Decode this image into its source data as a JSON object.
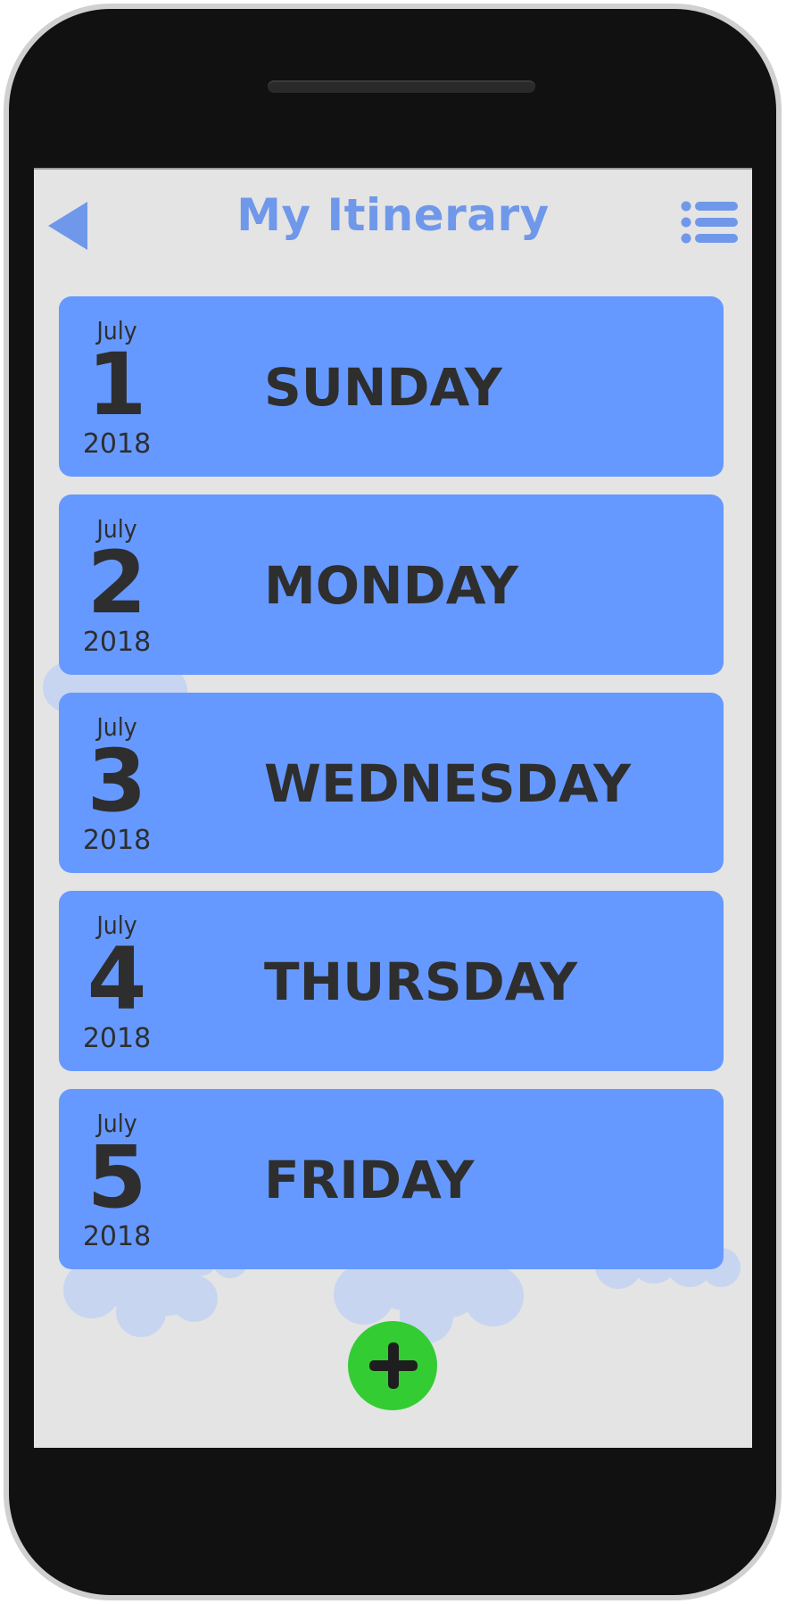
{
  "header": {
    "title": "My Itinerary",
    "back_icon": "back-arrow-icon",
    "menu_icon": "list-menu-icon"
  },
  "days": [
    {
      "month": "July",
      "day": "1",
      "year": "2018",
      "weekday": "SUNDAY"
    },
    {
      "month": "July",
      "day": "2",
      "year": "2018",
      "weekday": "MONDAY"
    },
    {
      "month": "July",
      "day": "3",
      "year": "2018",
      "weekday": "WEDNESDAY"
    },
    {
      "month": "July",
      "day": "4",
      "year": "2018",
      "weekday": "THURSDAY"
    },
    {
      "month": "July",
      "day": "5",
      "year": "2018",
      "weekday": "FRIDAY"
    }
  ],
  "add_button": {
    "icon": "plus-icon"
  },
  "colors": {
    "accent": "#6f98ea",
    "card": "#6699ff",
    "add": "#33cc33",
    "screen_bg": "#e4e4e4"
  }
}
